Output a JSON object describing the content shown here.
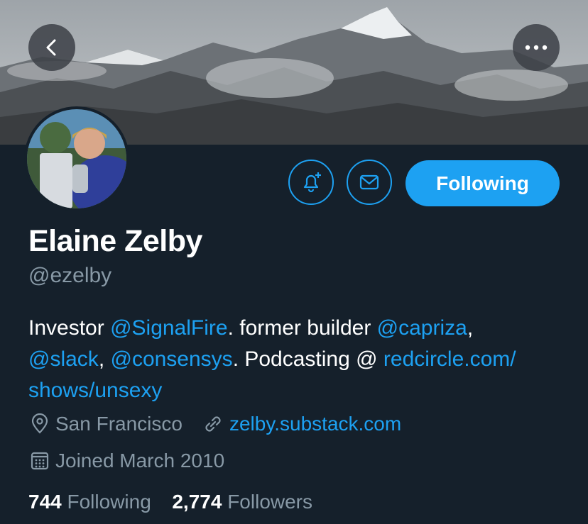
{
  "header": {
    "back_icon": "chevron-left-icon",
    "more_icon": "more-horizontal-icon"
  },
  "actions": {
    "notify_icon": "bell-plus-icon",
    "message_icon": "mail-icon",
    "follow_label": "Following"
  },
  "profile": {
    "name": "Elaine Zelby",
    "handle": "@ezelby",
    "bio": {
      "t1": "Investor ",
      "m1": "@SignalFire",
      "t2": ". former builder ",
      "m2": "@capriza",
      "t3": ",",
      "m3": "@slack",
      "t4": ", ",
      "m4": "@consensys",
      "t5": ". Podcasting @ ",
      "l1": "redcircle.com/",
      "l2": "shows/unsexy"
    },
    "location": "San Francisco",
    "website": "zelby.substack.com",
    "joined": "Joined March 2010"
  },
  "stats": {
    "following_count": "744",
    "following_label": "Following",
    "followers_count": "2,774",
    "followers_label": "Followers"
  },
  "colors": {
    "background": "#15202b",
    "accent": "#1da1f2",
    "secondary_text": "#8899a6"
  }
}
